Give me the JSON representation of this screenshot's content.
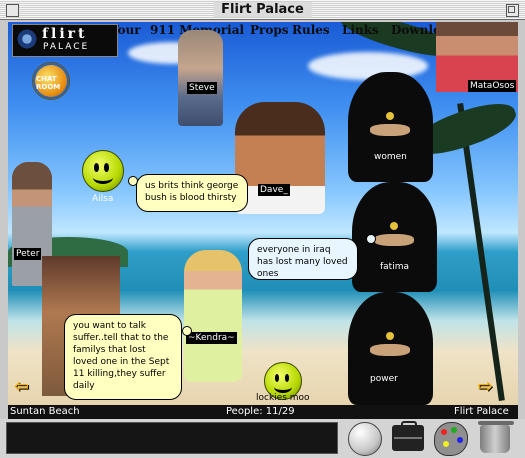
{
  "window": {
    "title": "Flirt Palace"
  },
  "logo": {
    "line1": "flirt",
    "line2": "PALACE"
  },
  "chat_button": {
    "label": "CHAT ROOM"
  },
  "nav": {
    "items": [
      "Tour",
      "911 Memorial",
      "Props",
      "Rules",
      "Links",
      "Download Palace"
    ]
  },
  "avatars": {
    "steve": "Steve",
    "mataosos": "MataOsos",
    "dave": "Dave_",
    "women": "women",
    "ailsa": "Ailsa",
    "peter": "Peter",
    "fatima": "fatima",
    "kendra": "~Kendra~",
    "power": "power",
    "lockies": "lockies moo"
  },
  "bubbles": {
    "ailsa": "us brits think george bush is blood thirsty",
    "fatima": "everyone in iraq has lost many loved ones",
    "kendra": "you want to talk suffer..tell that to the familys that lost loved one in the Sept 11 killing,they suffer daily"
  },
  "status": {
    "room": "Suntan Beach",
    "people": "People: 11/29",
    "server": "Flirt Palace"
  },
  "tools": [
    "face-ball-icon",
    "briefcase-icon",
    "paint-palette-icon",
    "trash-icon"
  ],
  "colors": {
    "bubble_yellow": "#ffffc0",
    "bubble_blue": "#e8f6ff",
    "arrow": "#f4b000"
  }
}
